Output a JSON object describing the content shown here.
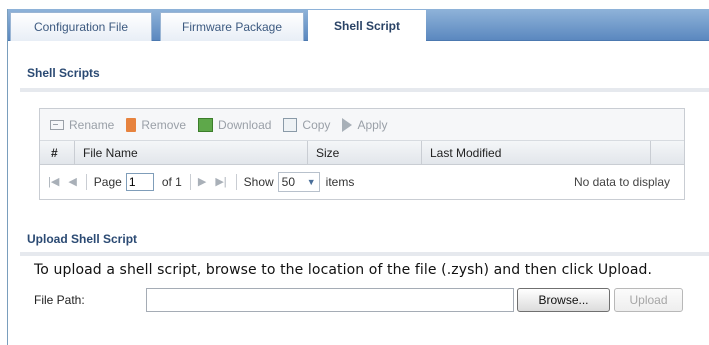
{
  "tabs": [
    {
      "label": "Configuration File"
    },
    {
      "label": "Firmware Package"
    },
    {
      "label": "Shell Script"
    }
  ],
  "shell_scripts": {
    "title": "Shell Scripts",
    "toolbar": {
      "rename": "Rename",
      "remove": "Remove",
      "download": "Download",
      "copy": "Copy",
      "apply": "Apply"
    },
    "columns": [
      "#",
      "File Name",
      "Size",
      "Last Modified"
    ],
    "pager": {
      "page_label": "Page",
      "page_value": "1",
      "of_label": "of 1",
      "show_label": "Show",
      "show_value": "50",
      "items_label": "items",
      "no_data": "No data to display"
    }
  },
  "upload": {
    "title": "Upload Shell Script",
    "instruction": "To upload a shell script, browse to the location of the file (.zysh) and then click Upload.",
    "file_path_label": "File Path:",
    "file_path_value": "",
    "browse_label": "Browse...",
    "upload_label": "Upload"
  }
}
